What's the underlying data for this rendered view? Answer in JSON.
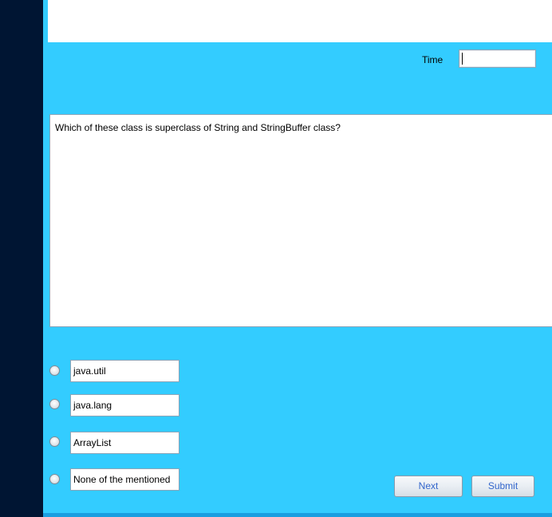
{
  "timer": {
    "label": "Time",
    "value": ""
  },
  "question": {
    "text": "Which of these class is superclass of String and StringBuffer class?"
  },
  "options": [
    {
      "text": "java.util"
    },
    {
      "text": "java.lang"
    },
    {
      "text": "ArrayList"
    },
    {
      "text": "None of the mentioned"
    }
  ],
  "buttons": {
    "next": "Next",
    "submit": "Submit"
  },
  "colors": {
    "background": "#33ccff",
    "sidebar": "#001533",
    "button_text": "#3366cc"
  }
}
